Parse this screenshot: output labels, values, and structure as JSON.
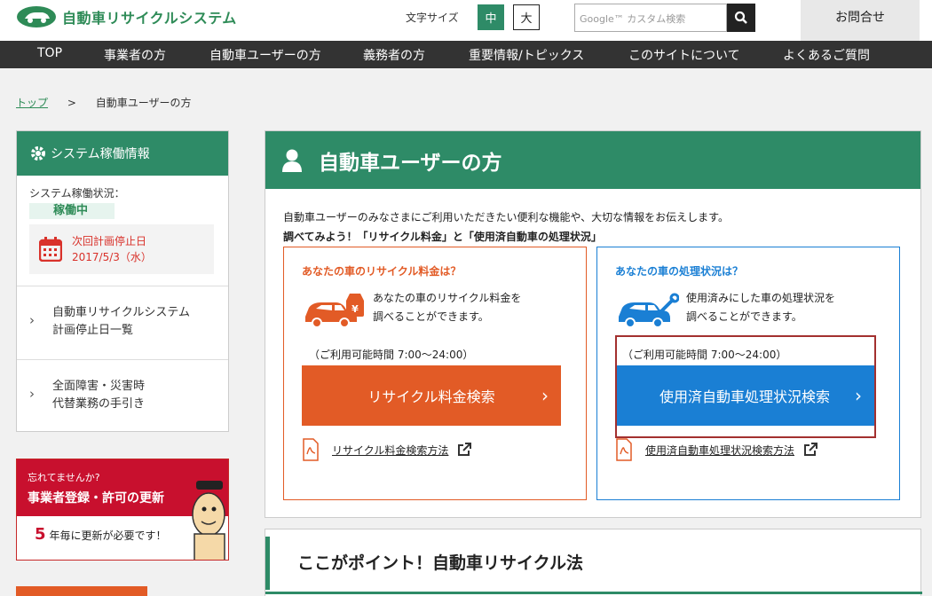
{
  "header": {
    "logo_text": "自動車リサイクルシステム",
    "font_size_label": "文字サイズ",
    "font_size_mid": "中",
    "font_size_large": "大",
    "search_placeholder": "Google™ カスタム検索",
    "contact": "お問合せ"
  },
  "nav": {
    "items": [
      "TOP",
      "事業者の方",
      "自動車ユーザーの方",
      "義務者の方",
      "重要情報/トピックス",
      "このサイトについて",
      "よくあるご質問"
    ]
  },
  "breadcrumb": {
    "home": "トップ",
    "separator": ">",
    "current": "自動車ユーザーの方"
  },
  "sidebar": {
    "status_title": "システム稼働情報",
    "status_label": "システム稼働状況：",
    "status_value": "稼働中",
    "next_stop_label": "次回計画停止日",
    "next_stop_date": "2017/5/3（水）",
    "links": [
      {
        "line1": "自動車リサイクルシステム",
        "line2": "計画停止日一覧"
      },
      {
        "line1": "全面障害・災害時",
        "line2": "代替業務の手引き"
      }
    ],
    "banner": {
      "small": "忘れてませんか?",
      "title": "事業者登録・許可の更新",
      "number": "5",
      "text": "年毎に更新が必要です！"
    }
  },
  "main": {
    "title": "自動車ユーザーの方",
    "intro": "自動車ユーザーのみなさまにご利用いただきたい便利な機能や、大切な情報をお伝えします。",
    "intro_bold": "調べてみよう！「リサイクル料金」と「使用済自動車の処理状況」",
    "cards": [
      {
        "title": "あなたの車のリサイクル料金は？",
        "desc1": "あなたの車のリサイクル料金を",
        "desc2": "調べることができます。",
        "hours": "（ご利用可能時間 7:00〜24:00）",
        "button": "リサイクル料金検索",
        "pdf_link": "リサイクル料金検索方法"
      },
      {
        "title": "あなたの車の処理状況は？",
        "desc1": "使用済みにした車の処理状況を",
        "desc2": "調べることができます。",
        "hours": "（ご利用可能時間 7:00〜24:00）",
        "button": "使用済自動車処理状況検索",
        "pdf_link": "使用済自動車処理状況検索方法"
      }
    ],
    "point_title": "ここがポイント！自動車リサイクル法"
  },
  "colors": {
    "green": "#2e8b67",
    "orange": "#e25b26",
    "blue": "#1a7fd4",
    "red": "#c8102e",
    "highlight": "#a3302f"
  }
}
